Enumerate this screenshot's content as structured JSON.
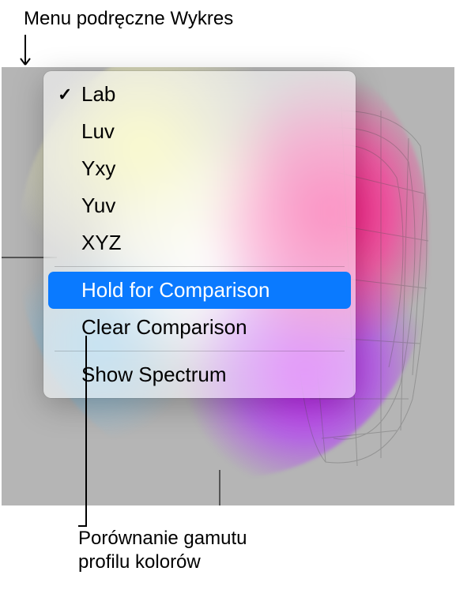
{
  "annotations": {
    "top_label": "Menu podręczne Wykres",
    "bottom_label_line1": "Porównanie gamutu",
    "bottom_label_line2": "profilu kolorów"
  },
  "menu": {
    "items": [
      {
        "label": "Lab",
        "checked": true
      },
      {
        "label": "Luv",
        "checked": false
      },
      {
        "label": "Yxy",
        "checked": false
      },
      {
        "label": "Yuv",
        "checked": false
      },
      {
        "label": "XYZ",
        "checked": false
      }
    ],
    "hold_label": "Hold for Comparison",
    "clear_label": "Clear Comparison",
    "spectrum_label": "Show Spectrum"
  }
}
